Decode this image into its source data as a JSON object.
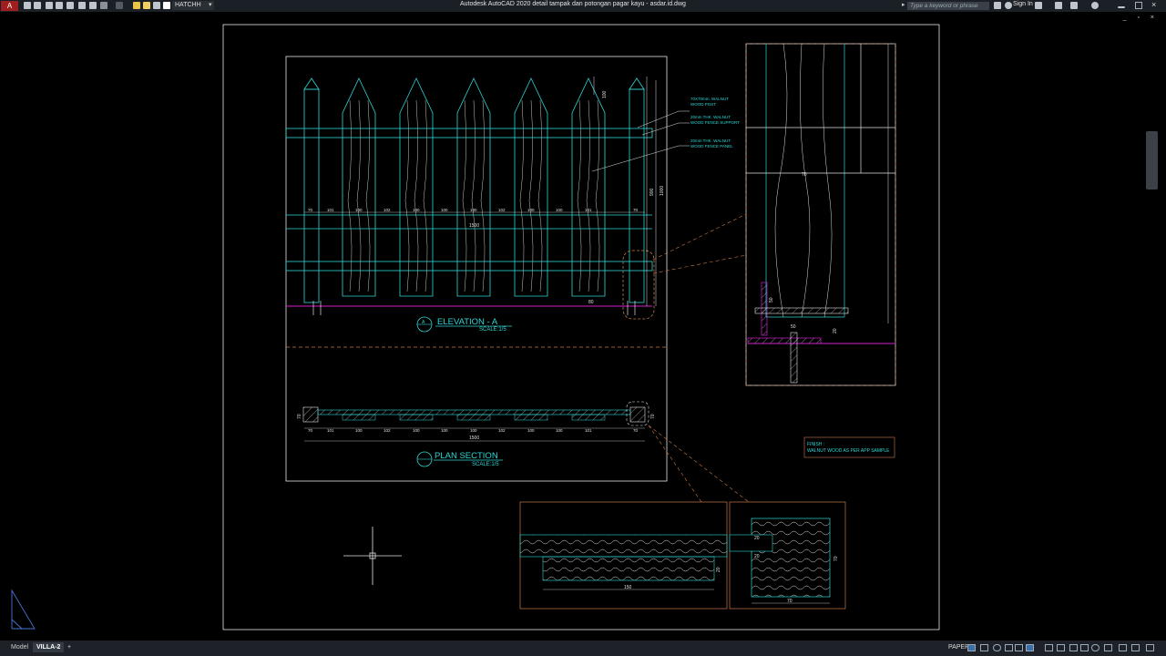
{
  "titlebar": {
    "app_menu": "A",
    "layer": "HATCHH",
    "window_title": "Autodesk AutoCAD 2020    detail tampak dan potongan pagar kayu - asdar.id.dwg",
    "search_placeholder": "Type a keyword or phrase",
    "sign_in": "Sign In"
  },
  "inner_window_controls": "_ ▫ ×",
  "drawing": {
    "elevation_title": "ELEVATION - A",
    "elevation_scale": "SCALE:1/5",
    "elevation_bubble": "A",
    "plan_title": "PLAN SECTION",
    "plan_scale": "SCALE:1/5",
    "notes": [
      {
        "line1": "70X70mm. WALNUT",
        "line2": "WOOD POST"
      },
      {
        "line1": "20mm THK. WALNUT",
        "line2": "WOOD FENCE SUPPORT"
      },
      {
        "line1": "20mm THK. WALNUT",
        "line2": "WOOD FENCE PANEL"
      }
    ],
    "finish_title": "FINISH :",
    "finish_text": "WALNUT WOOD AS PER APP SAMPLE",
    "elev_dims": [
      "70",
      "101",
      "100",
      "102",
      "100",
      "100",
      "100",
      "102",
      "100",
      "100",
      "101",
      "70"
    ],
    "elev_total": "1500",
    "elev_height": "1000",
    "elev_inner_height": "900",
    "elev_top": "100",
    "elev_bottom": "80",
    "plan_dims": [
      "70",
      "101",
      "100",
      "102",
      "100",
      "100",
      "100",
      "102",
      "100",
      "100",
      "101",
      "70"
    ],
    "plan_total": "1500",
    "plan_side": "70",
    "detail_dims": {
      "post": "70",
      "bolt": "50",
      "plate": "50",
      "base": "20",
      "bar_len": "150",
      "bar_h": "20",
      "post_size": "70",
      "side": "70",
      "a": "20",
      "b": "20"
    }
  },
  "layout_tabs": {
    "model": "Model",
    "villa": "VILLA-2",
    "add": "+"
  },
  "status": {
    "space": "PAPER"
  },
  "colors": {
    "cyan": "#2fd6d6",
    "white": "#e0e0e0",
    "magenta": "#d21fd2",
    "orange": "#c77a4a",
    "border": "#e6e6e6"
  }
}
